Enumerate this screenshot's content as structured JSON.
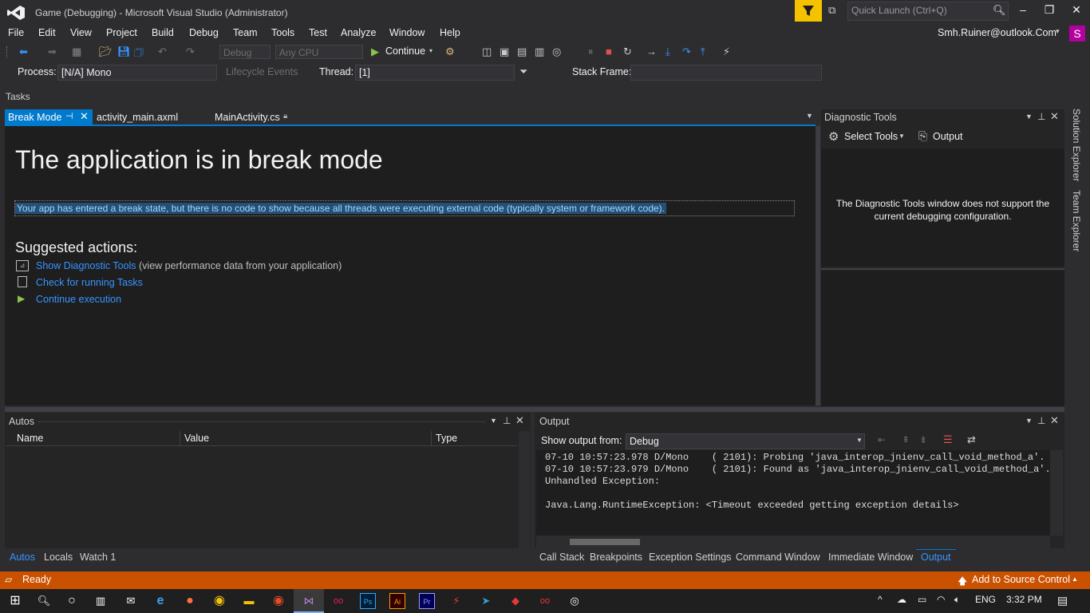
{
  "window": {
    "title": "Game (Debugging) - Microsoft Visual Studio  (Administrator)",
    "quick_launch_placeholder": "Quick Launch (Ctrl+Q)",
    "account": "Smh.Ruiner@outlook.Com",
    "avatar_letter": "S"
  },
  "menu": [
    "File",
    "Edit",
    "View",
    "Project",
    "Build",
    "Debug",
    "Team",
    "Tools",
    "Test",
    "Analyze",
    "Window",
    "Help"
  ],
  "toolbar": {
    "config": "Debug",
    "platform": "Any CPU",
    "continue_label": "Continue"
  },
  "debug_location": {
    "process_label": "Process:",
    "process_value": "[N/A] Mono",
    "lifecycle_label": "Lifecycle Events",
    "thread_label": "Thread:",
    "thread_value": "[1]",
    "stack_frame_label": "Stack Frame:",
    "stack_frame_value": ""
  },
  "tasks_label": "Tasks",
  "tabs": [
    {
      "label": "Break Mode",
      "active": true
    },
    {
      "label": "activity_main.axml",
      "active": false
    },
    {
      "label": "MainActivity.cs",
      "active": false
    }
  ],
  "break_mode": {
    "title": "The application is in break mode",
    "message": "Your app has entered a break state, but there is no code to show because all threads were executing external code (typically system or framework code).",
    "suggested_heading": "Suggested actions:",
    "actions": [
      {
        "label": "Show Diagnostic Tools",
        "note": "(view performance data from your application)"
      },
      {
        "label": "Check for running Tasks",
        "note": ""
      },
      {
        "label": "Continue execution",
        "note": ""
      }
    ]
  },
  "diagnostic_tools": {
    "title": "Diagnostic Tools",
    "select_tools": "Select Tools",
    "output": "Output",
    "message_line1": "The Diagnostic Tools window does not support the",
    "message_line2": "current debugging configuration."
  },
  "side_tabs": [
    "Solution Explorer",
    "Team Explorer"
  ],
  "autos": {
    "title": "Autos",
    "columns": [
      "Name",
      "Value",
      "Type"
    ]
  },
  "output_pane": {
    "title": "Output",
    "show_from_label": "Show output from:",
    "show_from_value": "Debug",
    "lines": [
      "07-10 10:57:23.978 D/Mono    ( 2101): Probing 'java_interop_jnienv_call_void_method_a'.",
      "07-10 10:57:23.979 D/Mono    ( 2101): Found as 'java_interop_jnienv_call_void_method_a'.",
      "Unhandled Exception:",
      "",
      "Java.Lang.RuntimeException: <Timeout exceeded getting exception details>"
    ]
  },
  "bottom_tabs_left": [
    "Autos",
    "Locals",
    "Watch 1"
  ],
  "bottom_tabs_right": [
    "Call Stack",
    "Breakpoints",
    "Exception Settings",
    "Command Window",
    "Immediate Window",
    "Output"
  ],
  "status": {
    "text": "Ready",
    "source_control": "Add to Source Control"
  },
  "tray": {
    "lang": "ENG",
    "time": "3:32 PM"
  },
  "colors": {
    "accent": "#007acc",
    "status_bar": "#ca5100",
    "link": "#3794ff"
  }
}
